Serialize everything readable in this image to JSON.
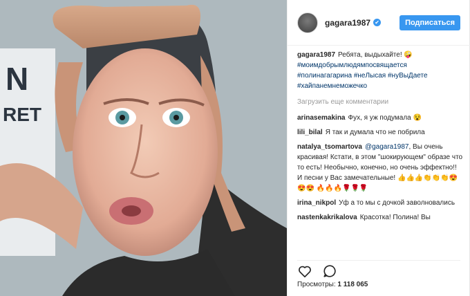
{
  "header": {
    "username": "gagara1987",
    "verified_mark": "✔",
    "follow_label": "Подписаться"
  },
  "caption": {
    "username": "gagara1987",
    "text": "Ребята, выдыхайте!",
    "emoji": "🤪",
    "hashtags": [
      "#моимдобрымлюдямпосвящается",
      "#полинагагарина",
      "#неЛысая",
      "#нуВыДаете",
      "#хайпанемнеможечко"
    ]
  },
  "load_more_label": "Загрузить еще комментарии",
  "comments": [
    {
      "user": "arinasemakina",
      "text": "Фух, я уж подумала 😵"
    },
    {
      "user": "lili_bilal",
      "text": "Я так и думала что не побрила"
    },
    {
      "user": "natalya_tsomartova",
      "mention": "@gagara1987",
      "text": ", Вы очень красивая! Кстати, в этом \"шокирующем\" образе что то есть! Необычно, конечно, но очень эффектно!! И песни у Вас замечательные! 👍👍👍👏👏👏😍😍😍 🔥🔥🔥🌹🌹🌹"
    },
    {
      "user": "irina_nikpol",
      "text": "Уф а то мы с дочкой заволновались"
    },
    {
      "user": "nastenkakrikalova",
      "text": "Красотка! Полина! Вы"
    }
  ],
  "icons": {
    "like": "heart-icon",
    "comment": "comment-icon"
  },
  "views": {
    "label": "Просмотры:",
    "value": "1 118 065"
  },
  "colors": {
    "accent": "#3897f0",
    "hashtag": "#003569"
  }
}
